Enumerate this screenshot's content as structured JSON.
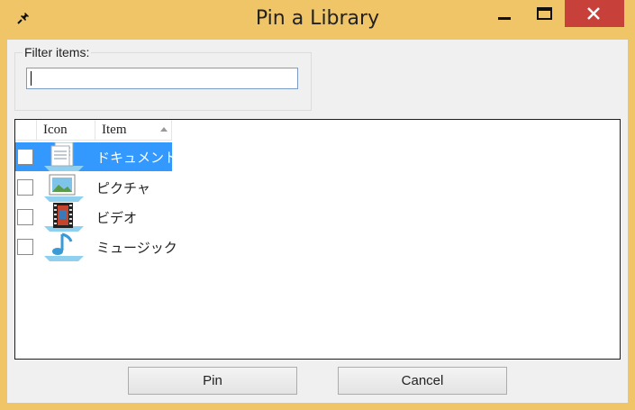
{
  "window": {
    "title": "Pin a Library",
    "icon": "pin-icon",
    "controls": [
      "minimize-icon",
      "maximize-icon",
      "close-icon"
    ],
    "accent_color": "#f0c567",
    "close_color": "#c7403a"
  },
  "filter": {
    "group_label": "Filter items:",
    "value": ""
  },
  "list": {
    "columns": [
      "",
      "Icon",
      "Item"
    ],
    "sort_icon": "sort-up-icon",
    "items": [
      {
        "label": "ドキュメント",
        "icon": "documents-library-icon",
        "checked": false,
        "selected": true
      },
      {
        "label": "ピクチャ",
        "icon": "pictures-library-icon",
        "checked": false,
        "selected": false
      },
      {
        "label": "ビデオ",
        "icon": "videos-library-icon",
        "checked": false,
        "selected": false
      },
      {
        "label": "ミュージック",
        "icon": "music-library-icon",
        "checked": false,
        "selected": false
      }
    ],
    "selection_color": "#3399ff"
  },
  "buttons": {
    "pin": "Pin",
    "cancel": "Cancel"
  }
}
